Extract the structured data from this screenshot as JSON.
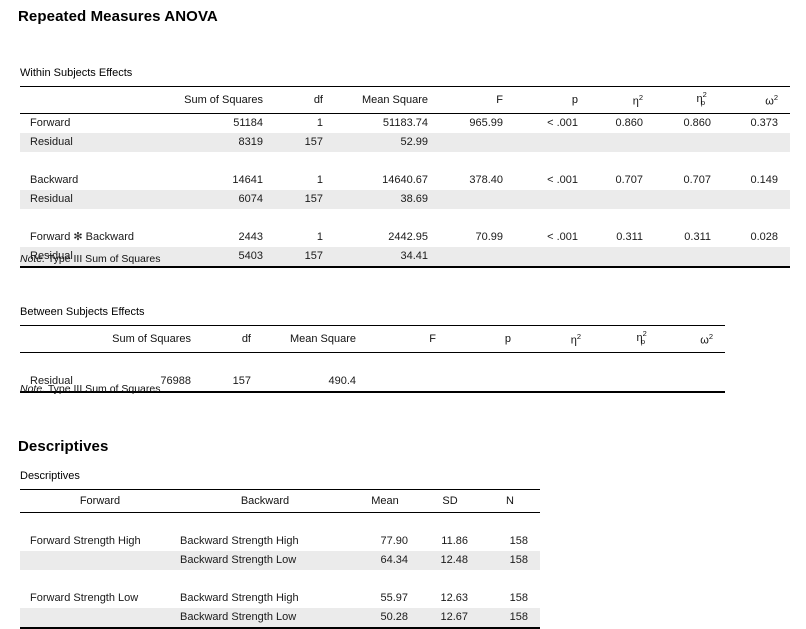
{
  "page": {
    "title": "Repeated Measures ANOVA",
    "descriptives_heading": "Descriptives"
  },
  "within_subjects": {
    "caption": "Within Subjects Effects",
    "columns": [
      "",
      "Sum of Squares",
      "df",
      "Mean Square",
      "F",
      "p",
      "η²",
      "η²p",
      "ω²"
    ],
    "rows": [
      {
        "effect": "Forward",
        "sum_of_squares": "51184",
        "df": "1",
        "mean_square": "51183.74",
        "F": "965.99",
        "p": "< .001",
        "eta_squared": "0.860",
        "partial_eta_squared": "0.860",
        "omega_squared": "0.373",
        "shaded": false
      },
      {
        "effect": "Residual",
        "sum_of_squares": "8319",
        "df": "157",
        "mean_square": "52.99",
        "F": "",
        "p": "",
        "eta_squared": "",
        "partial_eta_squared": "",
        "omega_squared": "",
        "shaded": true
      },
      {
        "effect": "Backward",
        "sum_of_squares": "14641",
        "df": "1",
        "mean_square": "14640.67",
        "F": "378.40",
        "p": "< .001",
        "eta_squared": "0.707",
        "partial_eta_squared": "0.707",
        "omega_squared": "0.149",
        "shaded": false
      },
      {
        "effect": "Residual",
        "sum_of_squares": "6074",
        "df": "157",
        "mean_square": "38.69",
        "F": "",
        "p": "",
        "eta_squared": "",
        "partial_eta_squared": "",
        "omega_squared": "",
        "shaded": true
      },
      {
        "effect": "Forward ✻ Backward",
        "sum_of_squares": "2443",
        "df": "1",
        "mean_square": "2442.95",
        "F": "70.99",
        "p": "< .001",
        "eta_squared": "0.311",
        "partial_eta_squared": "0.311",
        "omega_squared": "0.028",
        "shaded": false
      },
      {
        "effect": "Residual",
        "sum_of_squares": "5403",
        "df": "157",
        "mean_square": "34.41",
        "F": "",
        "p": "",
        "eta_squared": "",
        "partial_eta_squared": "",
        "omega_squared": "",
        "shaded": true
      }
    ],
    "note_label": "Note.",
    "note_text": " Type III Sum of Squares"
  },
  "between_subjects": {
    "caption": "Between Subjects Effects",
    "columns": [
      "",
      "Sum of Squares",
      "df",
      "Mean Square",
      "F",
      "p",
      "η²",
      "η²p",
      "ω²"
    ],
    "rows": [
      {
        "effect": "Residual",
        "sum_of_squares": "76988",
        "df": "157",
        "mean_square": "490.4",
        "F": "",
        "p": "",
        "eta_squared": "",
        "partial_eta_squared": "",
        "omega_squared": "",
        "shaded": false
      }
    ],
    "note_label": "Note.",
    "note_text": " Type III Sum of Squares"
  },
  "descriptives": {
    "caption": "Descriptives",
    "columns": [
      "Forward",
      "Backward",
      "Mean",
      "SD",
      "N"
    ],
    "rows": [
      {
        "forward": "Forward Strength High",
        "backward": "Backward Strength High",
        "mean": "77.90",
        "sd": "11.86",
        "n": "158",
        "shaded": false
      },
      {
        "forward": "",
        "backward": "Backward Strength Low",
        "mean": "64.34",
        "sd": "12.48",
        "n": "158",
        "shaded": true
      },
      {
        "forward": "Forward Strength Low",
        "backward": "Backward Strength High",
        "mean": "55.97",
        "sd": "12.63",
        "n": "158",
        "shaded": false
      },
      {
        "forward": "",
        "backward": "Backward Strength Low",
        "mean": "50.28",
        "sd": "12.67",
        "n": "158",
        "shaded": true
      }
    ]
  },
  "colors": {
    "background": "#ffffff",
    "text": "#1a1a1a",
    "rule": "#000000",
    "row_shade": "#ebebeb"
  }
}
